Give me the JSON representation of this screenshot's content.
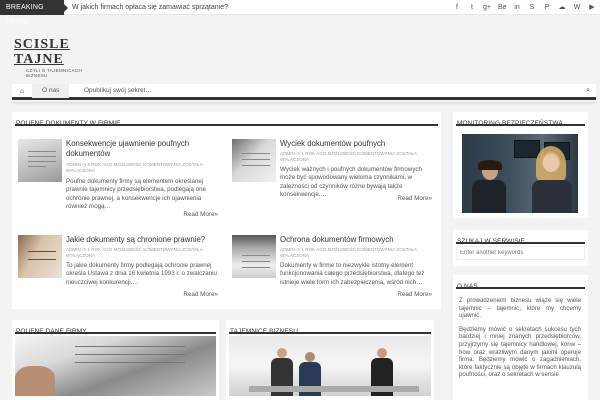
{
  "topbar": {
    "breaking_label": "BREAKING NEWS",
    "breaking_text": "W jakich firmach opłaca się zamawiać sprzątanie?",
    "social_icons": [
      "facebook-icon",
      "twitter-icon",
      "google-plus-icon",
      "behance-icon",
      "linkedin-icon",
      "skype-icon",
      "pinterest-icon",
      "soundcloud-icon",
      "whatsapp-icon",
      "youtube-icon"
    ],
    "social_glyphs": [
      "f",
      "t",
      "g+",
      "Be",
      "in",
      "S",
      "P",
      "☁",
      "W",
      "▶"
    ]
  },
  "logo": {
    "title": "SCISLE TAJNE",
    "subtitle": "CZYLI O TAJEMNICACH BIZNESU"
  },
  "nav": {
    "home_glyph": "⌂",
    "items": [
      "O nas",
      "Opublikuj swój sekret…"
    ],
    "search_glyph": "⌕"
  },
  "main_section": {
    "title": "POUFNE DOKUMENTY W FIRMIE",
    "posts": [
      {
        "title": "Konsekwencje ujawnienie poufnych dokumentów",
        "meta": "ADMIN ◷ 1 ROK AGO MOŻLIWOŚĆ KOMENTOWANIA ZOSTAŁA WYŁĄCZONA",
        "excerpt": "Poufne dokumenty firmy są elementem określanej prawnie tajemnicy przedsiębiorstwa, podlegają one ochronie prawnej, a konsekwencje ich ujawnienia również mogą…",
        "read_more": "Read More»"
      },
      {
        "title": "Wyciek dokumentów poufnych",
        "meta": "ADMIN ◷ 1 ROK AGO MOŻLIWOŚĆ KOMENTOWANIA ZOSTAŁA WYŁĄCZONA",
        "excerpt": "Wyciek ważnych i poufnych dokumentów firmowych może być spowodowany wieloma czynnikami, w zależności od czynników różne bywają także konsekwencje.…",
        "read_more": "Read More»"
      },
      {
        "title": "Jakie dokumenty są chronione prawnie?",
        "meta": "ADMIN ◷ 1 ROK AGO MOŻLIWOŚĆ KOMENTOWANIA ZOSTAŁA WYŁĄCZONA",
        "excerpt": "To jakie dokumenty firmy podlegają ochronie prawnej określa Ustawa z dnia 16 kwietnia 1993 r. o zwalczaniu nieuczciwej konkurencji.…",
        "read_more": "Read More»"
      },
      {
        "title": "Ochrona dokumentów firmowych",
        "meta": "ADMIN ◷ 1 ROK AGO MOŻLIWOŚĆ KOMENTOWANIA ZOSTAŁA WYŁĄCZONA",
        "excerpt": "Dokumenty w firmie to niezwykle istotny element funkcjonowania całego przedsiębiorstwa, dlatego też istnieje wiele form ich zabezpieczenia, wśród nich…",
        "read_more": "Read More»"
      }
    ]
  },
  "bottom_sections": [
    {
      "title": "POUFNE DANE FIRMY"
    },
    {
      "title": "TAJEMNICE BIZNESU"
    }
  ],
  "sidebar": {
    "monitoring_title": "MONITORING BEZPIECZEŃSTWA",
    "search_title": "SZUKAJ W SERWISIE",
    "search_placeholder": "Enter another keywords",
    "about_title": "O NAS",
    "about_paragraphs": [
      "Z prowadzeniem biznesu wiąże się wiele tajemnic – tajemnic, które my chcemy ujawnić.",
      "Będziemy mówić o sekretach sukcesu tych bardziej i mniej znanych przedsiębiorców, przyjrzymy się tajemnicy handlowej, konw – how oraz wrażliwym danym jakimi operuje firma. Będziemy mówić o zagadnieniach, które faktycznie są objęte w firmach klauzulą poufności, oraz o sekretach w sensie"
    ]
  }
}
